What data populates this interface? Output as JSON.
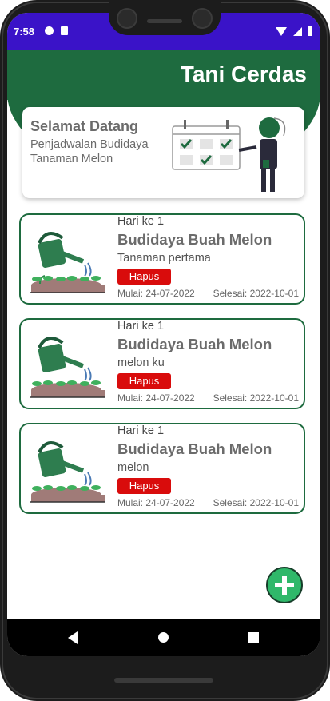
{
  "status_bar": {
    "time": "7:58"
  },
  "app": {
    "title": "Tani Cerdas"
  },
  "welcome": {
    "title": "Selamat Datang",
    "subtitle": "Penjadwalan Budidaya Tanaman Melon"
  },
  "schedules": [
    {
      "day": "Hari ke 1",
      "title": "Budidaya Buah Melon",
      "name": "Tanaman pertama",
      "delete_label": "Hapus",
      "start": "Mulai: 24-07-2022",
      "end": "Selesai: 2022-10-01"
    },
    {
      "day": "Hari ke 1",
      "title": "Budidaya Buah Melon",
      "name": "melon ku",
      "delete_label": "Hapus",
      "start": "Mulai: 24-07-2022",
      "end": "Selesai: 2022-10-01"
    },
    {
      "day": "Hari ke 1",
      "title": "Budidaya Buah Melon",
      "name": "melon",
      "delete_label": "Hapus",
      "start": "Mulai: 24-07-2022",
      "end": "Selesai: 2022-10-01"
    }
  ],
  "colors": {
    "primary_green": "#1e6b3f",
    "status_bar": "#3a13c8",
    "delete_red": "#d90c0c",
    "fab_green": "#2fb86a"
  },
  "icons": {
    "fab": "plus-icon",
    "card": "watering-can-icon",
    "nav": [
      "back-icon",
      "home-icon",
      "recents-icon"
    ]
  }
}
